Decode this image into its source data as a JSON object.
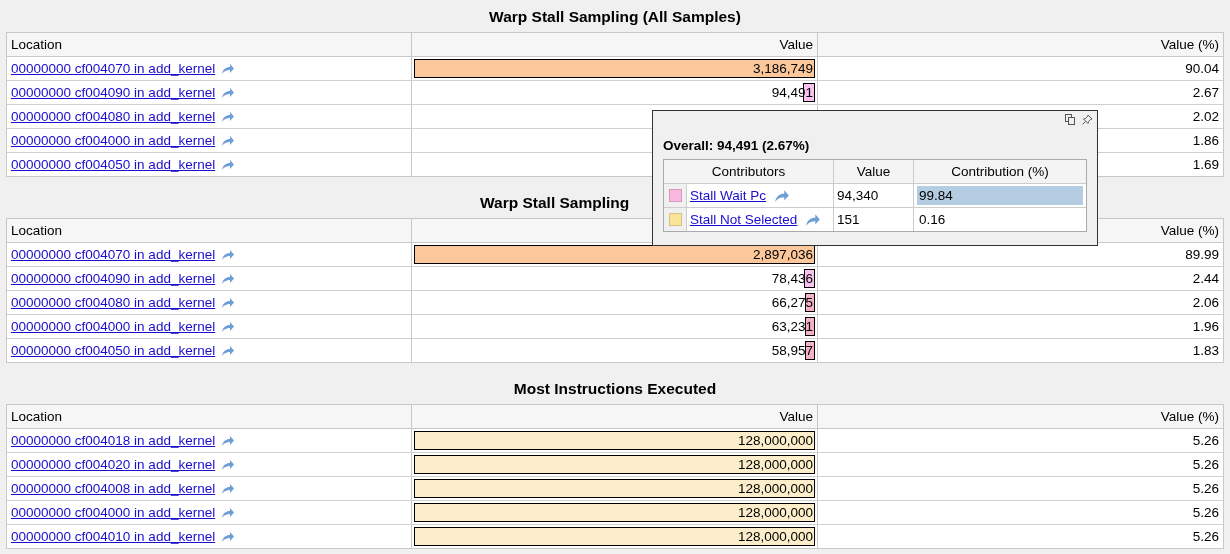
{
  "tables": [
    {
      "title": "Warp Stall Sampling (All Samples)",
      "partially_hidden": false,
      "columns": [
        "Location",
        "Value",
        "Value (%)"
      ],
      "rows": [
        {
          "location": "00000000 cf004070 in add_kernel",
          "value": "3,186,749",
          "level": 1.0,
          "color": "#fcc89b",
          "percent": "90.04"
        },
        {
          "location": "00000000 cf004090 in add_kernel",
          "value": "94,491",
          "level": 0.03,
          "color": "#f9c2ee",
          "percent": "2.67"
        },
        {
          "location": "00000000 cf004080 in add_kernel",
          "percent": "2.02"
        },
        {
          "location": "00000000 cf004000 in add_kernel",
          "percent": "1.86"
        },
        {
          "location": "00000000 cf004050 in add_kernel",
          "percent": "1.69"
        }
      ]
    },
    {
      "title": "Warp Stall Sampling",
      "partially_hidden": true,
      "columns": [
        "Location",
        "Value (%)"
      ],
      "rows": [
        {
          "location": "00000000 cf004070 in add_kernel",
          "value": "2,897,036",
          "level": 1.0,
          "color": "#fcc89b",
          "percent": "89.99"
        },
        {
          "location": "00000000 cf004090 in add_kernel",
          "value": "78,436",
          "level": 0.027,
          "color": "#f9c2ee",
          "percent": "2.44"
        },
        {
          "location": "00000000 cf004080 in add_kernel",
          "value": "66,275",
          "level": 0.023,
          "color": "#f5b0c8",
          "percent": "2.06"
        },
        {
          "location": "00000000 cf004000 in add_kernel",
          "value": "63,231",
          "level": 0.022,
          "color": "#f5b0c8",
          "percent": "1.96"
        },
        {
          "location": "00000000 cf004050 in add_kernel",
          "value": "58,957",
          "level": 0.02,
          "color": "#f5b0c8",
          "percent": "1.83"
        }
      ]
    },
    {
      "title": "Most Instructions Executed",
      "partially_hidden": false,
      "columns": [
        "Location",
        "Value",
        "Value (%)"
      ],
      "rows": [
        {
          "location": "00000000 cf004018 in add_kernel",
          "value": "128,000,000",
          "level": 1.0,
          "color": "#fdeecb",
          "percent": "5.26"
        },
        {
          "location": "00000000 cf004020 in add_kernel",
          "value": "128,000,000",
          "level": 1.0,
          "color": "#fdeecb",
          "percent": "5.26"
        },
        {
          "location": "00000000 cf004008 in add_kernel",
          "value": "128,000,000",
          "level": 1.0,
          "color": "#fdeecb",
          "percent": "5.26"
        },
        {
          "location": "00000000 cf004000 in add_kernel",
          "value": "128,000,000",
          "level": 1.0,
          "color": "#fdeecb",
          "percent": "5.26"
        },
        {
          "location": "00000000 cf004010 in add_kernel",
          "value": "128,000,000",
          "level": 1.0,
          "color": "#fdeecb",
          "percent": "5.26"
        }
      ]
    }
  ],
  "tooltip": {
    "overall": "Overall: 94,491 (2.67%)",
    "columns": [
      "Contributors",
      "Value",
      "Contribution (%)"
    ],
    "rows": [
      {
        "color": "#f9b7e0",
        "name": "Stall Wait Pc",
        "value": "94,340",
        "contribution": "99.84",
        "selected": true
      },
      {
        "color": "#f9e49a",
        "name": "Stall Not Selected",
        "value": "151",
        "contribution": "0.16",
        "selected": false
      }
    ]
  }
}
